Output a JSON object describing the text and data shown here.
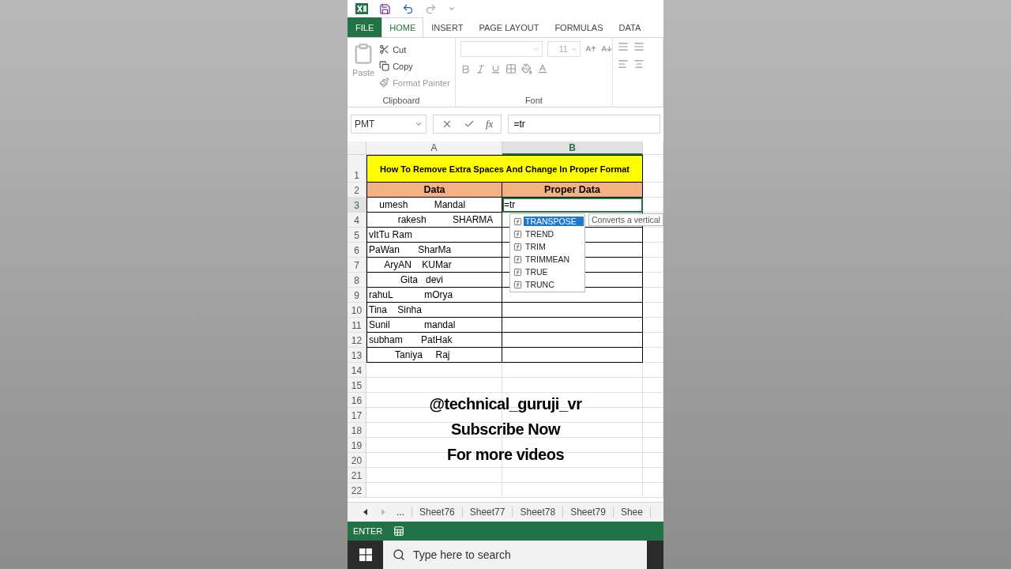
{
  "ribbon_tabs": [
    {
      "label": "FILE",
      "kind": "file",
      "selected": false
    },
    {
      "label": "HOME",
      "kind": "tab",
      "selected": true
    },
    {
      "label": "INSERT",
      "kind": "tab",
      "selected": false
    },
    {
      "label": "PAGE LAYOUT",
      "kind": "tab",
      "selected": false
    },
    {
      "label": "FORMULAS",
      "kind": "tab",
      "selected": false
    },
    {
      "label": "DATA",
      "kind": "tab",
      "selected": false
    }
  ],
  "clipboard": {
    "paste": "Paste",
    "cut": "Cut",
    "copy": "Copy",
    "format_painter": "Format Painter",
    "group_label": "Clipboard"
  },
  "font": {
    "size": "11",
    "group_label": "Font"
  },
  "formula_bar": {
    "name_box": "PMT",
    "fx": "fx",
    "formula": "=tr"
  },
  "columns": [
    {
      "label": "A",
      "selected": false
    },
    {
      "label": "B",
      "selected": true
    }
  ],
  "title_row": {
    "number": "1",
    "text": "How To Remove Extra Spaces And Change In Proper Format"
  },
  "header_row": {
    "number": "2",
    "cells": [
      "Data",
      "Proper Data"
    ]
  },
  "data_rows": [
    {
      "number": "3",
      "data": "    umesh          Mandal",
      "proper": "=tr",
      "selected": true
    },
    {
      "number": "4",
      "data": "           rakesh          SHARMA",
      "proper": "",
      "selected": false
    },
    {
      "number": "5",
      "data": "vItTu Ram",
      "proper": "",
      "selected": false
    },
    {
      "number": "6",
      "data": "PaWan       SharMa",
      "proper": "",
      "selected": false
    },
    {
      "number": "7",
      "data": "      AryAN    KUMar",
      "proper": "",
      "selected": false
    },
    {
      "number": "8",
      "data": "            Gita   devi",
      "proper": "",
      "selected": false
    },
    {
      "number": "9",
      "data": "rahuL            mOrya",
      "proper": "",
      "selected": false
    },
    {
      "number": "10",
      "data": "Tina    Sinha",
      "proper": "",
      "selected": false
    },
    {
      "number": "11",
      "data": "Sunil             mandal",
      "proper": "",
      "selected": false
    },
    {
      "number": "12",
      "data": "subham       PatHak",
      "proper": "",
      "selected": false
    },
    {
      "number": "13",
      "data": "          Taniya     Raj",
      "proper": "",
      "selected": false
    }
  ],
  "empty_rows": [
    "14",
    "15",
    "16",
    "17",
    "18",
    "19",
    "20",
    "21",
    "22"
  ],
  "autocomplete": {
    "items": [
      {
        "label": "TRANSPOSE",
        "selected": true
      },
      {
        "label": "TREND",
        "selected": false
      },
      {
        "label": "TRIM",
        "selected": false
      },
      {
        "label": "TRIMMEAN",
        "selected": false
      },
      {
        "label": "TRUE",
        "selected": false
      },
      {
        "label": "TRUNC",
        "selected": false
      }
    ],
    "tooltip": "Converts a vertical"
  },
  "overlay_text": [
    "@technical_guruji_vr",
    "Subscribe Now",
    "For more videos"
  ],
  "sheet_tabs": {
    "more": "...",
    "tabs": [
      "Sheet76",
      "Sheet77",
      "Sheet78",
      "Sheet79",
      "Shee"
    ]
  },
  "status_bar": {
    "mode": "ENTER"
  },
  "taskbar": {
    "search_placeholder": "Type here to search"
  }
}
